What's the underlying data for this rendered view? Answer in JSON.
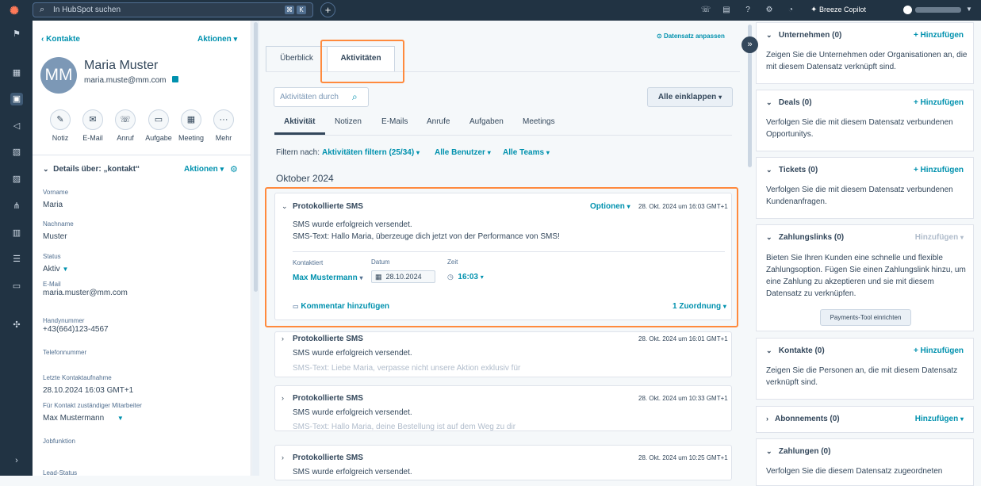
{
  "topbar": {
    "search_placeholder": "In HubSpot suchen",
    "kbd1": "⌘",
    "kbd2": "K",
    "copilot": "Breeze Copilot"
  },
  "left": {
    "back": "Kontakte",
    "actions": "Aktionen",
    "initials": "MM",
    "name": "Maria Muster",
    "email": "maria.muste@mm.com",
    "quick_actions": [
      {
        "label": "Notiz",
        "icon": "✎"
      },
      {
        "label": "E-Mail",
        "icon": "✉"
      },
      {
        "label": "Anruf",
        "icon": "☏"
      },
      {
        "label": "Aufgabe",
        "icon": "▭"
      },
      {
        "label": "Meeting",
        "icon": "▦"
      },
      {
        "label": "Mehr",
        "icon": "···"
      }
    ],
    "details_title": "Details über: „kontakt“",
    "details_actions": "Aktionen",
    "fields": [
      {
        "label": "Vorname",
        "value": "Maria"
      },
      {
        "label": "Nachname",
        "value": "Muster"
      },
      {
        "label": "Status",
        "value": "Aktiv"
      },
      {
        "label": "E-Mail",
        "value": "maria.muster@mm.com"
      },
      {
        "label": "Handynummer",
        "value": "+43(664)123-4567"
      },
      {
        "label": "Telefonnummer",
        "value": ""
      },
      {
        "label": "Letzte Kontaktaufnahme",
        "value": "28.10.2024 16:03 GMT+1"
      },
      {
        "label": "Für Kontakt zuständiger Mitarbeiter",
        "value": "Max Mustermann"
      },
      {
        "label": "Jobfunktion",
        "value": ""
      },
      {
        "label": "Lead-Status",
        "value": ""
      }
    ]
  },
  "center": {
    "customize": "Datensatz anpassen",
    "tabs": [
      "Überblick",
      "Aktivitäten"
    ],
    "search_placeholder": "Aktivitäten durch",
    "collapse_all": "Alle einklappen",
    "subtabs": [
      "Aktivität",
      "Notizen",
      "E-Mails",
      "Anrufe",
      "Aufgaben",
      "Meetings"
    ],
    "filter_label": "Filtern nach:",
    "filter_activities": "Aktivitäten filtern (25/34)",
    "filter_users": "Alle Benutzer",
    "filter_teams": "Alle Teams",
    "month": "Oktober 2024",
    "expanded": {
      "title": "Protokollierte SMS",
      "options": "Optionen",
      "timestamp": "28. Okt. 2024 um 16:03 GMT+1",
      "line1": "SMS wurde erfolgreich versendet.",
      "line2": "SMS-Text: Hallo Maria, überzeuge dich jetzt von der Performance von SMS!",
      "contacted_label": "Kontaktiert",
      "contacted_value": "Max Mustermann",
      "date_label": "Datum",
      "date_value": "28.10.2024",
      "time_label": "Zeit",
      "time_value": "16:03",
      "comment": "Kommentar hinzufügen",
      "assoc": "1 Zuordnung"
    },
    "entries": [
      {
        "title": "Protokollierte SMS",
        "timestamp": "28. Okt. 2024 um 16:01 GMT+1",
        "line1": "SMS wurde erfolgreich versendet.",
        "line2": "SMS-Text: Liebe Maria, verpasse nicht unsere Aktion exklusiv für"
      },
      {
        "title": "Protokollierte SMS",
        "timestamp": "28. Okt. 2024 um 10:33 GMT+1",
        "line1": "SMS wurde erfolgreich versendet.",
        "line2": "SMS-Text: Hallo Maria, deine Bestellung ist auf dem Weg zu dir"
      },
      {
        "title": "Protokollierte SMS",
        "timestamp": "28. Okt. 2024 um 10:25 GMT+1",
        "line1": "SMS wurde erfolgreich versendet.",
        "line2": ""
      }
    ]
  },
  "right": {
    "add": "+ Hinzufügen",
    "add_plain": "Hinzufügen",
    "payments_button": "Payments-Tool einrichten",
    "sections": [
      {
        "title": "Unternehmen (0)",
        "body": "Zeigen Sie die Unternehmen oder Organisationen an, die mit diesem Datensatz verknüpft sind."
      },
      {
        "title": "Deals (0)",
        "body": "Verfolgen Sie die mit diesem Datensatz verbundenen Opportunitys."
      },
      {
        "title": "Tickets (0)",
        "body": "Verfolgen Sie die mit diesem Datensatz verbundenen Kundenanfragen."
      },
      {
        "title": "Zahlungslinks (0)",
        "body": "Bieten Sie Ihren Kunden eine schnelle und flexible Zahlungsoption. Fügen Sie einen Zahlungslink hinzu, um eine Zahlung zu akzeptieren und sie mit diesem Datensatz zu verknüpfen."
      },
      {
        "title": "Kontakte (0)",
        "body": "Zeigen Sie die Personen an, die mit diesem Datensatz verknüpft sind."
      },
      {
        "title": "Abonnements (0)",
        "body": ""
      },
      {
        "title": "Zahlungen (0)",
        "body": "Verfolgen Sie die diesem Datensatz zugeordneten"
      }
    ]
  },
  "colors": {
    "accent": "#0091ae",
    "highlight": "#ff8a3d",
    "nav": "#213343"
  }
}
